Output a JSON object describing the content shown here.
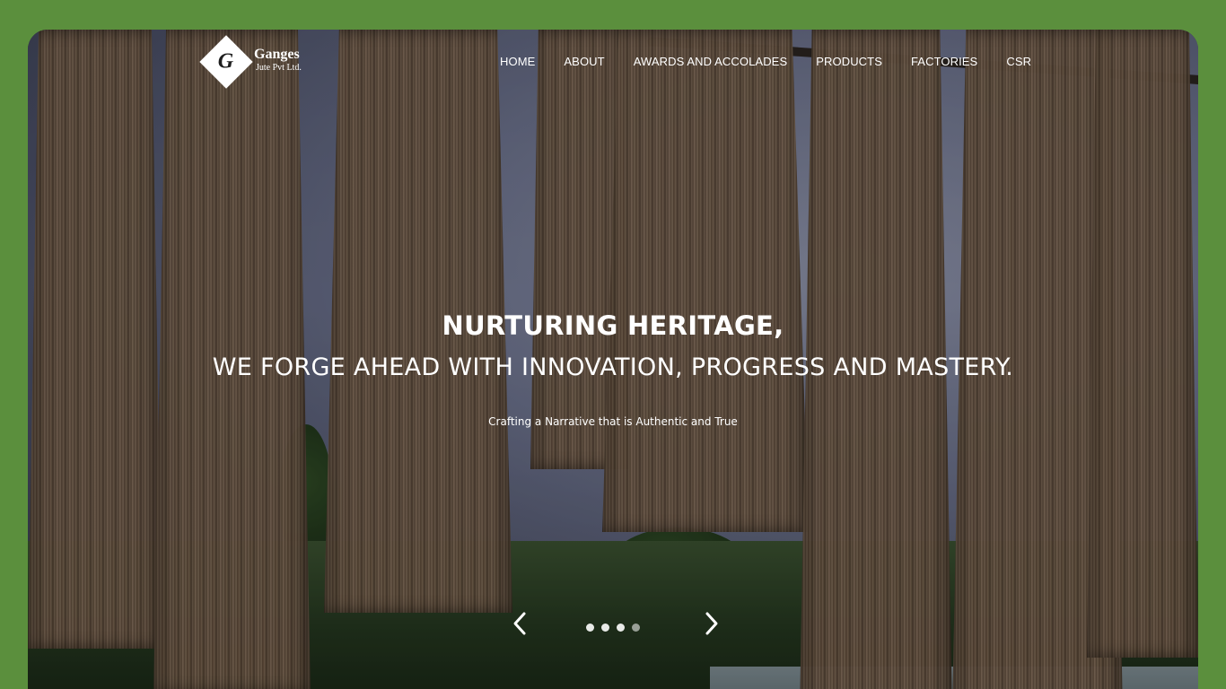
{
  "brand": {
    "logo_letter": "G",
    "name": "Ganges",
    "subtitle": "Jute Pvt Ltd."
  },
  "nav": {
    "items": [
      {
        "label": "HOME"
      },
      {
        "label": "ABOUT"
      },
      {
        "label": "AWARDS AND ACCOLADES"
      },
      {
        "label": "PRODUCTS"
      },
      {
        "label": "FACTORIES"
      },
      {
        "label": "CSR"
      }
    ]
  },
  "hero": {
    "title": "NURTURING HERITAGE,",
    "subtitle": "WE FORGE AHEAD WITH INNOVATION, PROGRESS AND MASTERY.",
    "tagline": "Crafting a Narrative that is Authentic and True"
  },
  "carousel": {
    "prev_icon": "chevron-left-icon",
    "next_icon": "chevron-right-icon",
    "slide_count": 4,
    "active_slide": 4
  },
  "colors": {
    "page_background": "#5b8f3d",
    "text": "#ffffff"
  }
}
